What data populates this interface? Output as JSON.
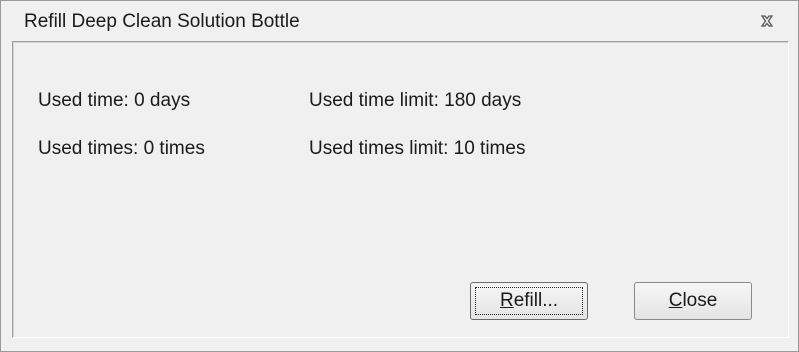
{
  "window": {
    "title": "Refill Deep Clean Solution Bottle"
  },
  "info": {
    "used_time": "Used time: 0 days",
    "used_time_limit": "Used time limit: 180 days",
    "used_times": "Used times: 0 times",
    "used_times_limit": "Used times limit: 10 times"
  },
  "buttons": {
    "refill": {
      "mnemonic": "R",
      "rest": "efill..."
    },
    "close": {
      "mnemonic": "C",
      "rest": "lose"
    }
  },
  "icons": {
    "close": "close-icon"
  },
  "colors": {
    "dialog_bg": "#f0f0f0",
    "text": "#1a1a1a",
    "border": "#9a9a9a"
  }
}
